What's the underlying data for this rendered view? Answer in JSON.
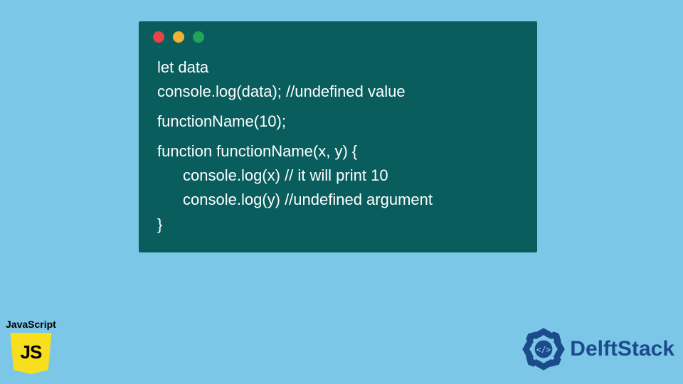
{
  "code": {
    "line1": "let data",
    "line2": "console.log(data); //undefined value",
    "line3": "functionName(10);",
    "line4": "function functionName(x, y) {",
    "line5": "console.log(x) // it will print 10",
    "line6": "console.log(y) //undefined argument",
    "line7": "}"
  },
  "badges": {
    "js_label": "JavaScript",
    "js_shield": "JS",
    "delft": "DelftStack"
  },
  "colors": {
    "bg": "#7cc7e8",
    "window": "#0a5d5d",
    "js_yellow": "#f7df1e",
    "delft_blue": "#1b4b8a"
  }
}
